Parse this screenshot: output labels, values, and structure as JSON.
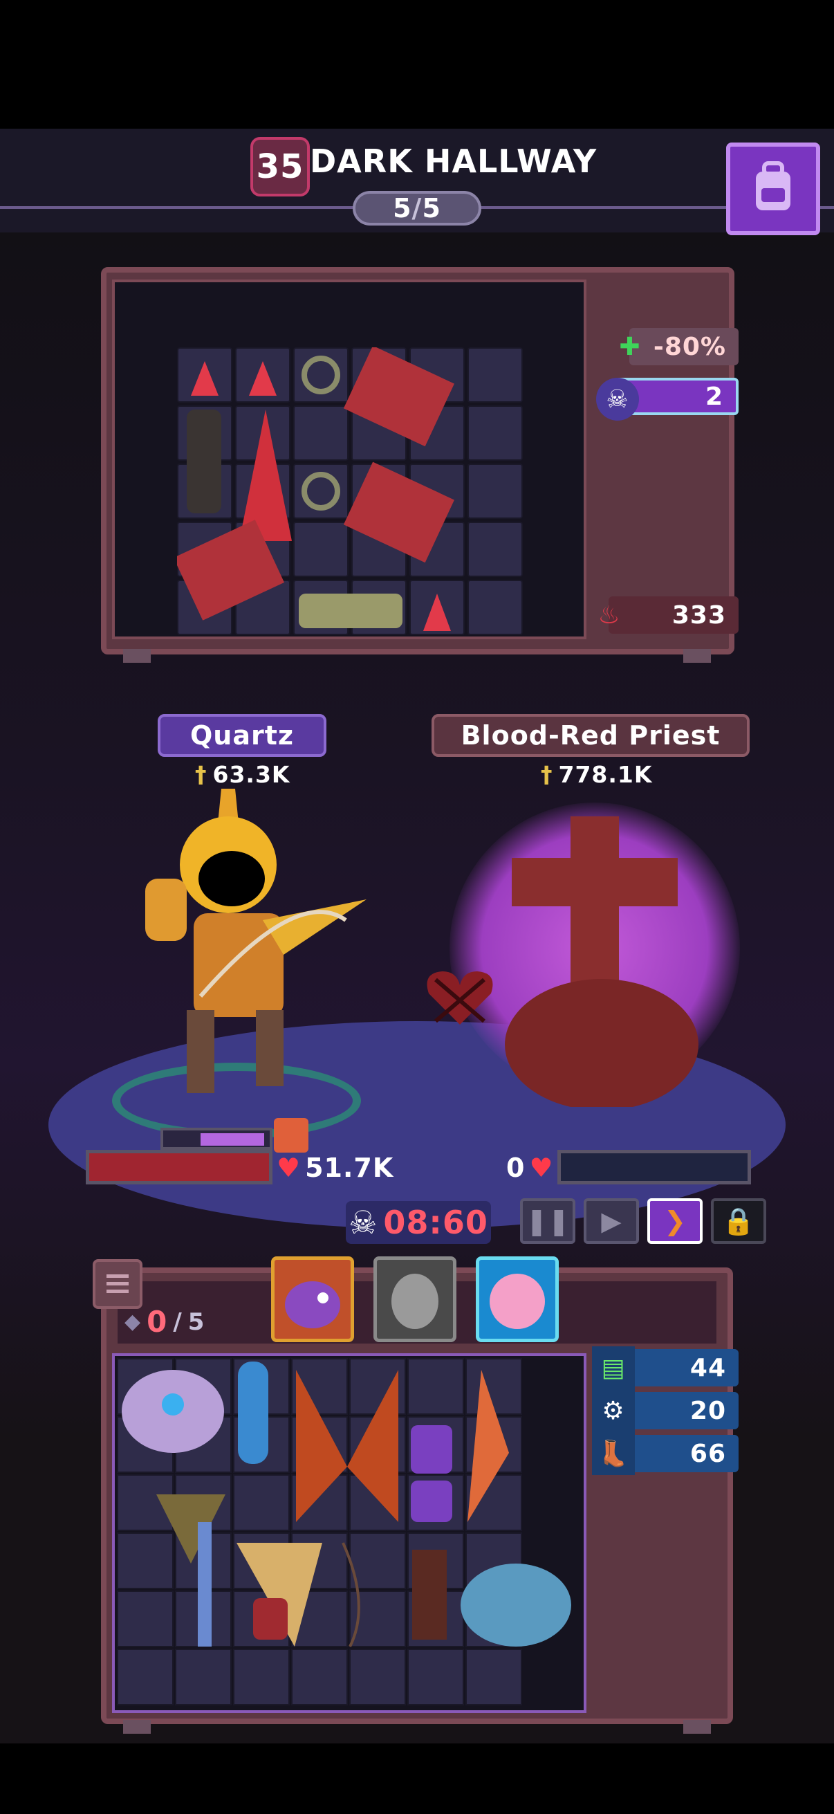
{
  "stage": {
    "level": "35",
    "title": "DARK HALLWAY",
    "wave_current": "5",
    "wave_total": "5"
  },
  "enemy_panel": {
    "stats": [
      {
        "icon": "heal-reduction-icon",
        "value": "-80%"
      },
      {
        "icon": "skull-icon",
        "value": "2"
      },
      {
        "icon": "enemy-strength-icon",
        "value": "333"
      }
    ]
  },
  "hero": {
    "name": "Quartz",
    "power": "63.3K",
    "hp": "51.7K",
    "mana_fraction": 0.6
  },
  "enemy": {
    "name": "Blood-Red Priest",
    "power": "778.1K",
    "hp": "0"
  },
  "timer": "08:60",
  "controls": {
    "pause": "pause-icon",
    "play": "play-icon",
    "fast_forward": "fast-forward-icon",
    "lock": "lock-icon"
  },
  "inventory": {
    "gems": "0",
    "gems_total": "5",
    "stats": [
      {
        "icon": "book-stack-icon",
        "value": "44"
      },
      {
        "icon": "gear-icon",
        "value": "20"
      },
      {
        "icon": "boot-icon",
        "value": "66"
      }
    ]
  },
  "colors": {
    "accent_purple": "#7a35c0",
    "hp_red": "#a02530",
    "timer_red": "#ff5a6a"
  }
}
